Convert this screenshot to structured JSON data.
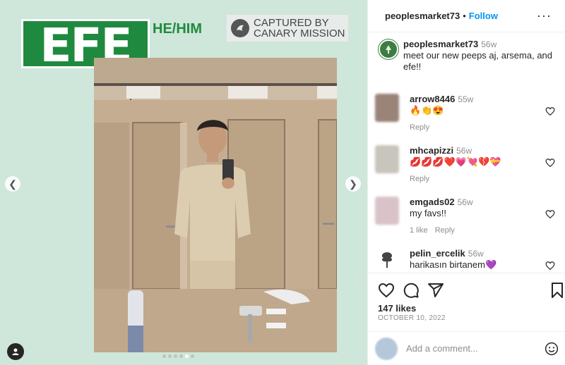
{
  "media": {
    "name_graphic": "EFE",
    "pronouns": "HE/HIM",
    "watermark_line1": "CAPTURED BY",
    "watermark_line2": "CANARY MISSION",
    "prev_icon": "chevron-left-icon",
    "next_icon": "chevron-right-icon",
    "carousel_dots": 6,
    "active_dot": 4,
    "background_color": "#cfe6da",
    "brand_green": "#1f8a3f"
  },
  "header": {
    "username": "peoplesmarket73",
    "separator": "•",
    "follow_label": "Follow",
    "more_icon": "more-horizontal-icon"
  },
  "caption": {
    "username": "peoplesmarket73",
    "time": "56w",
    "text": "meet our new peeps aj, arsema, and efe!!"
  },
  "comments": [
    {
      "username": "arrow8446",
      "time": "55w",
      "text": "🔥👏😍",
      "reply_label": "Reply",
      "likes": ""
    },
    {
      "username": "mhcapizzi",
      "time": "56w",
      "text": "💋💋💋❤️💗💘💔💝",
      "reply_label": "Reply",
      "likes": ""
    },
    {
      "username": "emgads02",
      "time": "56w",
      "text": "my favs!!",
      "reply_label": "Reply",
      "likes": "1 like"
    },
    {
      "username": "pelin_ercelik",
      "time": "56w",
      "text": "harikasın birtanem💜",
      "reply_label": "",
      "likes": ""
    }
  ],
  "actions": {
    "like_icon": "heart-icon",
    "comment_icon": "comment-icon",
    "share_icon": "share-icon",
    "save_icon": "bookmark-icon",
    "likes_count": "147 likes",
    "date": "OCTOBER 10, 2022"
  },
  "add_comment": {
    "placeholder": "Add a comment...",
    "emoji_icon": "emoji-icon"
  },
  "colors": {
    "accent": "#0095f6",
    "text": "#262626",
    "muted": "#8e8e8e"
  }
}
